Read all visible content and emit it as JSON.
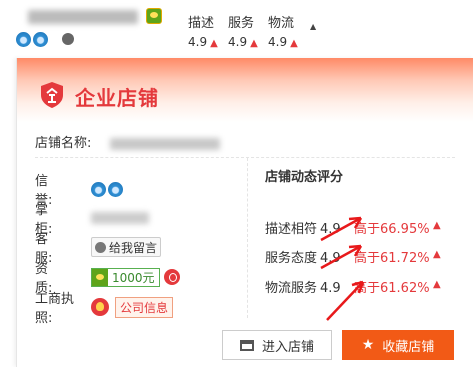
{
  "topbar": {
    "ratings": [
      {
        "label": "描述",
        "value": "4.9"
      },
      {
        "label": "服务",
        "value": "4.9"
      },
      {
        "label": "物流",
        "value": "4.9"
      }
    ],
    "caret": "▲"
  },
  "card": {
    "title": "企业店铺",
    "shop_name_label": "店铺名称:",
    "info": {
      "credit_label": "信　　誉:",
      "owner_label": "掌　　柜:",
      "service_label": "客　　服:",
      "service_msg": "给我留言",
      "funds_label": "资　　质:",
      "funds_amount": "1000元",
      "license_label": "工商执照:",
      "license_value": "公司信息"
    },
    "rating": {
      "title": "店铺动态评分",
      "rows": [
        {
          "name": "描述相符",
          "score": "4.9",
          "compare": "高于66.95%"
        },
        {
          "name": "服务态度",
          "score": "4.9",
          "compare": "高于61.72%"
        },
        {
          "name": "物流服务",
          "score": "4.9",
          "compare": "高于61.62%"
        }
      ]
    },
    "buttons": {
      "enter": "进入店铺",
      "favorite": "收藏店铺"
    }
  },
  "colors": {
    "accent": "#e4393c",
    "button_orange": "#f25a16",
    "annotation_red": "#e8191b"
  }
}
